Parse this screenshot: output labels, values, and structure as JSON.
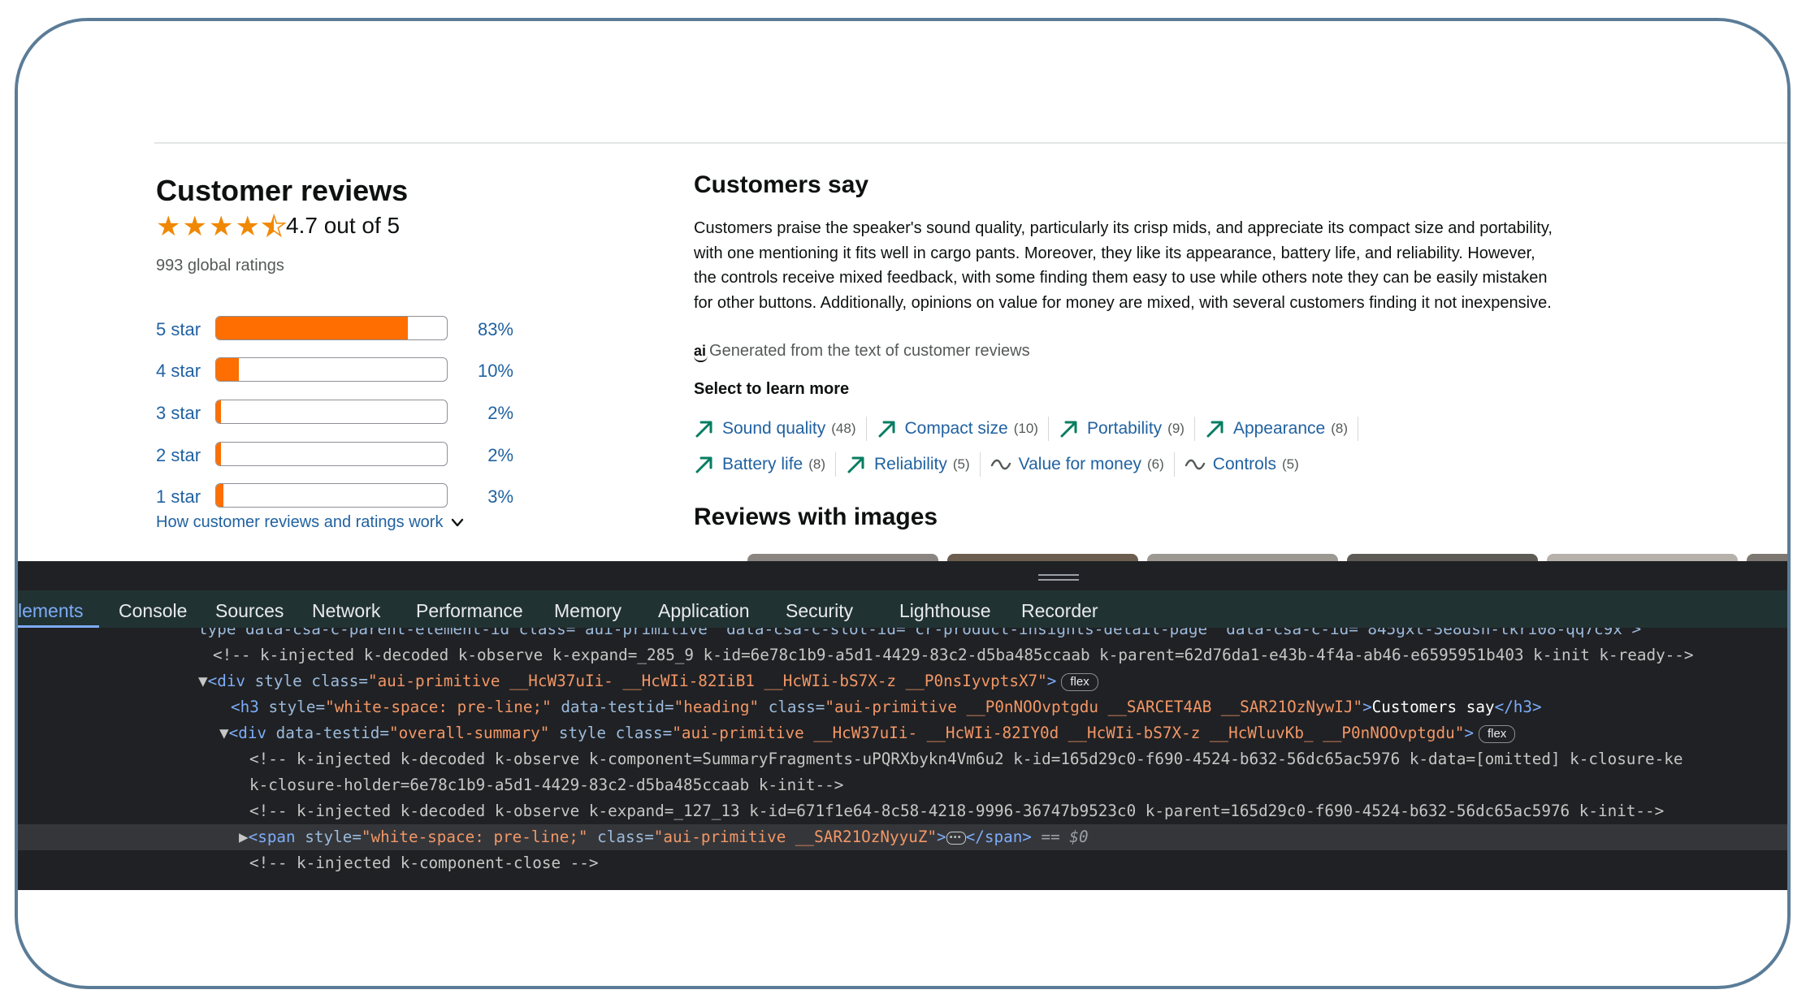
{
  "reviews": {
    "title": "Customer reviews",
    "average": 4.7,
    "out_of": "4.7 out of 5",
    "global_ratings": "993 global ratings",
    "breakdown": [
      {
        "label": "5 star",
        "percent": 83,
        "percent_label": "83%"
      },
      {
        "label": "4 star",
        "percent": 10,
        "percent_label": "10%"
      },
      {
        "label": "3 star",
        "percent": 2,
        "percent_label": "2%"
      },
      {
        "label": "2 star",
        "percent": 2,
        "percent_label": "2%"
      },
      {
        "label": "1 star",
        "percent": 3,
        "percent_label": "3%"
      }
    ],
    "how_link": "How customer reviews and ratings work"
  },
  "customers_say": {
    "title": "Customers say",
    "summary": "Customers praise the speaker's sound quality, particularly its crisp mids, and appreciate its compact size and portability, with one mentioning it fits well in cargo pants. Moreover, they like its appearance, battery life, and reliability. However, the controls receive mixed feedback, with some finding them easy to use while others note they can be easily mistaken for other buttons. Additionally, opinions on value for money are mixed, with several customers finding it not inexpensive.",
    "ai_badge": "ai",
    "generated_note": "Generated from the text of customer reviews",
    "select_label": "Select to learn more",
    "aspects_row1": [
      {
        "label": "Sound quality",
        "count": "(48)",
        "icon": "trend-up-icon"
      },
      {
        "label": "Compact size",
        "count": "(10)",
        "icon": "trend-up-icon"
      },
      {
        "label": "Portability",
        "count": "(9)",
        "icon": "trend-up-icon"
      },
      {
        "label": "Appearance",
        "count": "(8)",
        "icon": "trend-up-icon"
      }
    ],
    "aspects_row2": [
      {
        "label": "Battery life",
        "count": "(8)",
        "icon": "trend-up-icon"
      },
      {
        "label": "Reliability",
        "count": "(5)",
        "icon": "trend-up-icon"
      },
      {
        "label": "Value for money",
        "count": "(6)",
        "icon": "mixed-wave-icon"
      },
      {
        "label": "Controls",
        "count": "(5)",
        "icon": "mixed-wave-icon"
      }
    ],
    "reviews_with_images": "Reviews with images"
  },
  "colors": {
    "star": "#f08804",
    "bar_fill": "#ff6e00",
    "link": "#2162a1",
    "trend_up": "#067d62"
  },
  "devtools": {
    "tabs": [
      "lements",
      "Console",
      "Sources",
      "Network",
      "Performance",
      "Memory",
      "Application",
      "Security",
      "Lighthouse",
      "Recorder"
    ],
    "active_tab": "lements",
    "lines": {
      "l0": "type data-csa-c-parent-element-id class= aui-primitive  data-csa-c-slot-id= cr-product-insights-detail-page  data-csa-c-id= 845gxt-3e8dsn-tkri08-qq7c9x >",
      "l1": "<!-- k-injected k-decoded k-observe k-expand=_285_9 k-id=6e78c1b9-a5d1-4429-83c2-d5ba485ccaab k-parent=62d76da1-e43b-4f4a-ab46-e6595951b403 k-init k-ready-->",
      "l2_tag": "div",
      "l2_attr1": "style",
      "l2_attr2": "class",
      "l2_val2": "\"aui-primitive __HcW37uIi- __HcWIi-82IiB1 __HcWIi-bS7X-z __P0nsIyvptsX7\"",
      "l2_badge": "flex",
      "l3_tag": "h3",
      "l3_attr1": "style",
      "l3_val1": "\"white-space: pre-line;\"",
      "l3_attr2": "data-testid",
      "l3_val2": "\"heading\"",
      "l3_attr3": "class",
      "l3_val3": "\"aui-primitive __P0nNOOvptgdu __SARCET4AB __SAR21OzNywIJ\"",
      "l3_text": "Customers say",
      "l4_tag": "div",
      "l4_attr1": "data-testid",
      "l4_val1": "\"overall-summary\"",
      "l4_attr2": "style",
      "l4_attr3": "class",
      "l4_val3": "\"aui-primitive __HcW37uIi- __HcWIi-82IY0d __HcWIi-bS7X-z __HcWluvKb_ __P0nNOOvptgdu\"",
      "l4_badge": "flex",
      "l5": "<!-- k-injected k-decoded k-observe k-component=SummaryFragments-uPQRXbykn4Vm6u2 k-id=165d29c0-f690-4524-b632-56dc65ac5976 k-data=[omitted] k-closure-ke",
      "l6": "k-closure-holder=6e78c1b9-a5d1-4429-83c2-d5ba485ccaab k-init-->",
      "l7": "<!-- k-injected k-decoded k-observe k-expand=_127_13 k-id=671f1e64-8c58-4218-9996-36747b9523c0 k-parent=165d29c0-f690-4524-b632-56dc65ac5976 k-init-->",
      "l8_tag": "span",
      "l8_attr1": "style",
      "l8_val1": "\"white-space: pre-line;\"",
      "l8_attr2": "class",
      "l8_val2": "\"aui-primitive __SAR21OzNyyuZ\"",
      "l8_eq": "== $0",
      "l9": "<!-- k-injected k-component-close -->"
    }
  }
}
